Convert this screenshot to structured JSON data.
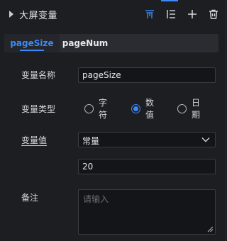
{
  "header": {
    "title": "大屏变量",
    "icons": [
      "filter-icon",
      "list-settings-icon",
      "add-icon",
      "delete-icon"
    ],
    "accent": "#3d8af7"
  },
  "tabs": [
    {
      "label": "pageSize",
      "active": true
    },
    {
      "label": "pageNum",
      "active": false
    }
  ],
  "form": {
    "name_label": "变量名称",
    "name_value": "pageSize",
    "type_label": "变量类型",
    "type_options": [
      {
        "label": "字符",
        "selected": false
      },
      {
        "label": "数值",
        "selected": true
      },
      {
        "label": "日期",
        "selected": false
      }
    ],
    "value_label": "变量值",
    "value_mode": "常量",
    "value": "20",
    "remark_label": "备注",
    "remark_placeholder": "请输入"
  }
}
